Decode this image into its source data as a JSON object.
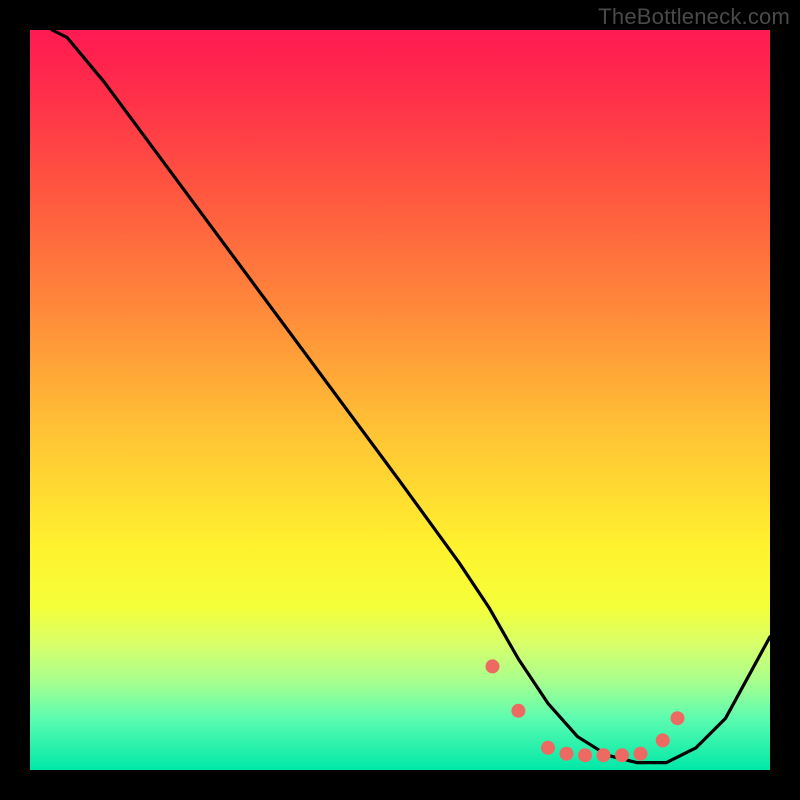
{
  "watermark": "TheBottleneck.com",
  "chart_data": {
    "type": "line",
    "title": "",
    "xlabel": "",
    "ylabel": "",
    "xlim": [
      0,
      100
    ],
    "ylim": [
      0,
      100
    ],
    "main_curve": {
      "name": "bottleneck-curve",
      "x": [
        3,
        5,
        10,
        20,
        30,
        40,
        50,
        58,
        62,
        66,
        70,
        74,
        78,
        82,
        86,
        90,
        94,
        100
      ],
      "y": [
        100,
        99,
        93,
        79.5,
        66,
        52.5,
        39,
        28,
        22,
        15,
        9,
        4.5,
        2,
        1,
        1,
        3,
        7,
        18
      ]
    },
    "dots": {
      "name": "optimal-zone-points",
      "color": "#ed6a63",
      "x": [
        62.5,
        66,
        70,
        72.5,
        75,
        77.5,
        80,
        82.5,
        85.5,
        87.5
      ],
      "y": [
        14,
        8,
        3,
        2.2,
        2,
        2,
        2,
        2.2,
        4,
        7
      ]
    },
    "background_gradient": {
      "top_color": "#ff1a52",
      "mid_color": "#fff22e",
      "bottom_color": "#00e8a8"
    }
  }
}
